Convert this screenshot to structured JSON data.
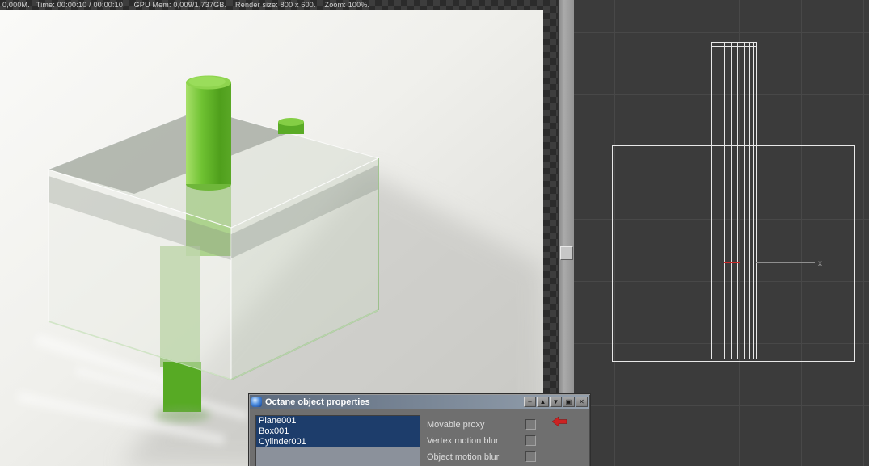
{
  "render_window": {
    "status_bar": "0,000M.   Time: 00:00:10 / 00:00:10.    GPU Mem: 0,009/1,737GB.    Render size: 800 x 600.    Zoom: 100%."
  },
  "viewport": {
    "axis_label": "x"
  },
  "dialog": {
    "title": "Octane object properties",
    "buttons": [
      "–",
      "▲",
      "▼",
      "▣",
      "✕"
    ],
    "objects": [
      {
        "label": "Plane001",
        "selected": true
      },
      {
        "label": "Box001",
        "selected": true
      },
      {
        "label": "Cylinder001",
        "selected": true
      }
    ],
    "options": [
      {
        "label": "Movable proxy",
        "checked": false
      },
      {
        "label": "Vertex motion blur",
        "checked": false
      },
      {
        "label": "Object motion blur",
        "checked": false
      }
    ]
  },
  "colors": {
    "cylinder_green": "#5cb226",
    "selection_navy": "#1d3d6b",
    "viewport_bg": "#3b3b3b",
    "titlebar_from": "#5c6a7d",
    "titlebar_to": "#95a1ae",
    "cursor_red": "#cc2222"
  }
}
